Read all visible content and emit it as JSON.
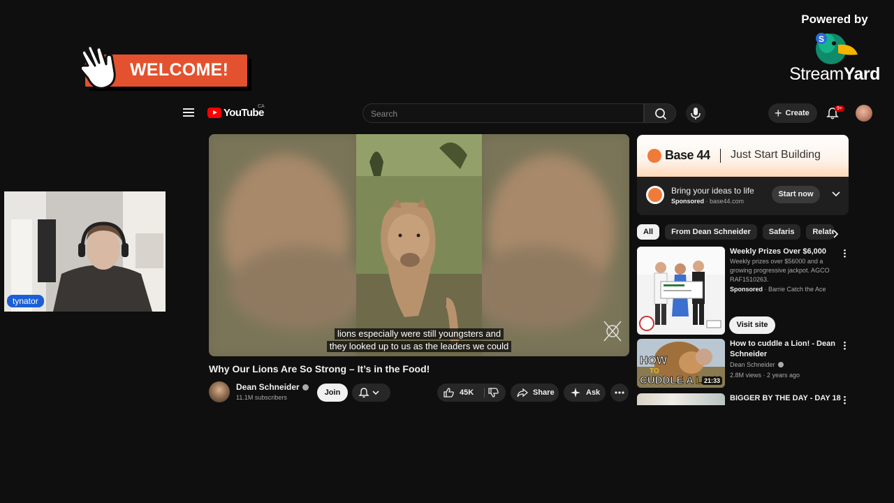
{
  "overlay": {
    "powered_by": "Powered by",
    "brand_a": "Stream",
    "brand_b": "Yard",
    "welcome": "WELCOME!",
    "participant": "tynator"
  },
  "youtube": {
    "logo_text": "YouTube",
    "country": "CA",
    "search_placeholder": "Search",
    "create_label": "Create",
    "notif_count": "9+",
    "video": {
      "subtitle_line1": "lions especially were still youngsters and",
      "subtitle_line2": "they looked up to us as the leaders we could",
      "title": "Why Our Lions Are So Strong – It’s in the Food!",
      "channel": "Dean Schneider",
      "subscribers": "11.1M subscribers",
      "join": "Join",
      "likes": "45K",
      "share": "Share",
      "ask": "Ask"
    },
    "ad": {
      "brand": "Base 44",
      "tagline": "Just Start Building",
      "headline": "Bring your ideas to life",
      "sponsored": "Sponsored",
      "domain": "base44.com",
      "cta": "Start now"
    },
    "chips": [
      "All",
      "From Dean Schneider",
      "Safaris",
      "Relate"
    ],
    "recs": [
      {
        "title": "Weekly Prizes Over $6,000",
        "desc": "Weekly prizes over $56000 and a growing progressive jackpot. AGCO RAF1510263.",
        "sponsored": "Sponsored",
        "source": "Barrie Catch the Ace",
        "cta": "Visit site"
      },
      {
        "title": "How to cuddle a Lion! - Dean Schneider",
        "channel": "Dean Schneider",
        "meta": "2.8M views · 2 years ago",
        "duration": "21:33",
        "thumb_text": "HOW TO CUDDLE A LION"
      },
      {
        "title": "BIGGER BY THE DAY - DAY 18 -"
      }
    ]
  },
  "colors": {
    "welcome_orange": "#e4512e",
    "yt_red": "#ff0000",
    "badge_blue": "#1a5fd6"
  }
}
